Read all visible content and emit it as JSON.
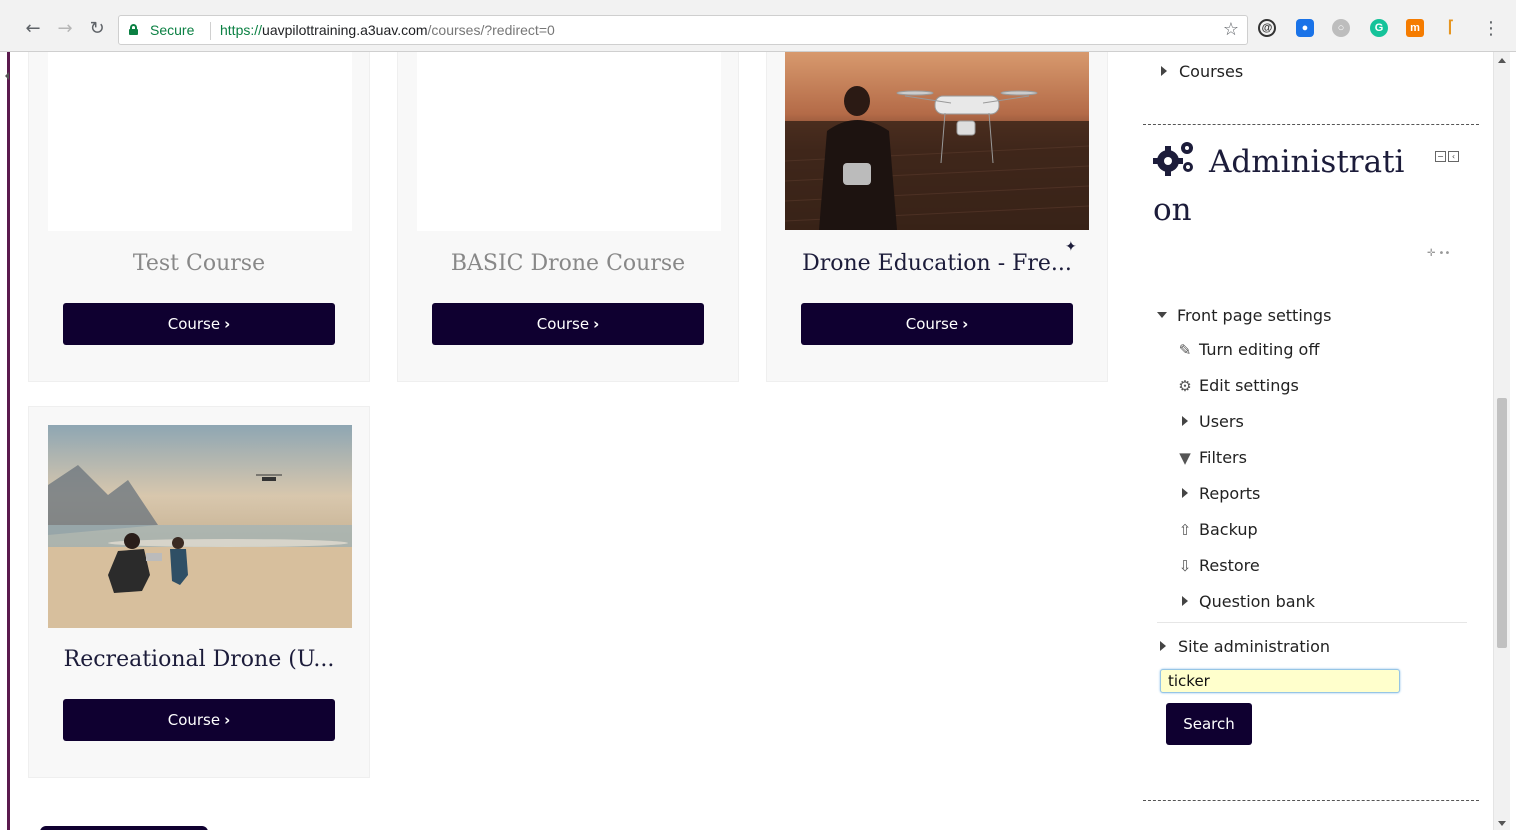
{
  "browser": {
    "secure_label": "Secure",
    "url_scheme": "https://",
    "url_host": "uavpilottraining.a3uav.com",
    "url_path": "/courses/?redirect=0",
    "back_icon": "arrow-left-icon",
    "forward_icon": "arrow-right-icon",
    "reload_icon": "reload-icon",
    "bookmark_icon": "star-icon",
    "menu_icon": "kebab-menu-icon"
  },
  "courses": [
    {
      "title": "Test Course",
      "button_label": "Course",
      "has_image": false
    },
    {
      "title": "BASIC Drone Course",
      "button_label": "Course",
      "has_image": false
    },
    {
      "title": "Drone Education - Fre...",
      "button_label": "Course",
      "has_image": true
    },
    {
      "title": "Recreational Drone (U...",
      "button_label": "Course",
      "has_image": true
    }
  ],
  "sidebar": {
    "courses_link": "Courses",
    "admin_title_line1": "Administrati",
    "admin_title_line2": "on",
    "front_page_settings": "Front page settings",
    "items": [
      {
        "label": "Turn editing off",
        "icon": "pencil-icon"
      },
      {
        "label": "Edit settings",
        "icon": "gear-icon"
      },
      {
        "label": "Users",
        "icon": "caret-right-icon"
      },
      {
        "label": "Filters",
        "icon": "filter-icon"
      },
      {
        "label": "Reports",
        "icon": "caret-right-icon"
      },
      {
        "label": "Backup",
        "icon": "upload-icon"
      },
      {
        "label": "Restore",
        "icon": "download-icon"
      },
      {
        "label": "Question bank",
        "icon": "caret-right-icon"
      }
    ],
    "site_administration": "Site administration",
    "search_value": "ticker",
    "search_button": "Search"
  },
  "colors": {
    "button_bg": "#0f0030",
    "secure_green": "#0b8043",
    "title_dark": "#1c1c3a",
    "title_muted": "#888888",
    "input_bg": "#ffffcc"
  }
}
